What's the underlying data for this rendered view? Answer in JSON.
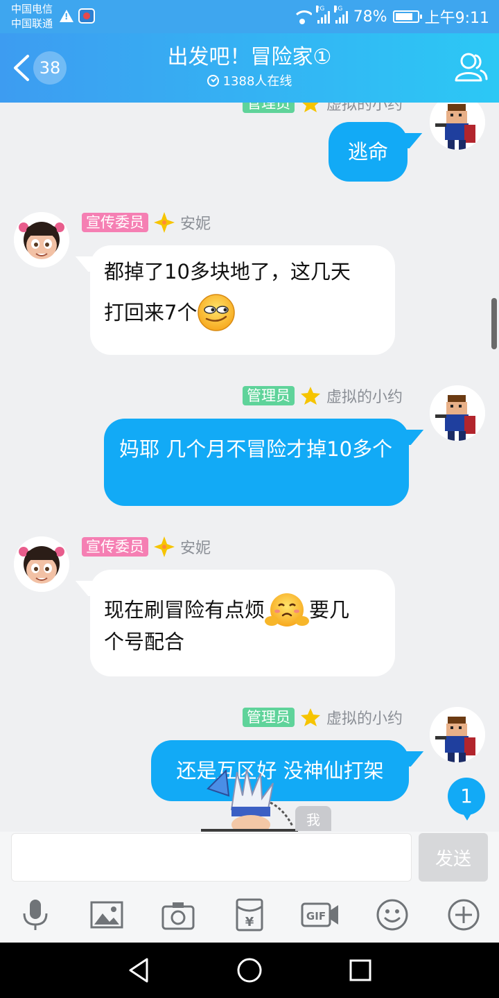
{
  "status_bar": {
    "carrier1": "中国电信",
    "carrier2": "中国联通",
    "signal1_label": "2G",
    "signal2_label": "4G",
    "battery": "78%",
    "time": "上午9:11"
  },
  "header": {
    "back_count": "38",
    "title": "出发吧！冒险家①",
    "online": "1388人在线",
    "colors": {
      "gradient_start": "#3d9cf1",
      "gradient_end": "#2cc8f5"
    }
  },
  "messages": [
    {
      "side": "right",
      "text": "逃命"
    },
    {
      "side": "left",
      "badge": "宣传委员",
      "name": "安妮",
      "line1": "都掉了10多块地了，这几天",
      "line2": "打回来7个",
      "emoji": "smirk-emoji"
    },
    {
      "side": "right",
      "badge": "管理员",
      "name": "虚拟的小约",
      "text": "妈耶 几个月不冒险才掉10多个"
    },
    {
      "side": "left",
      "badge": "宣传委员",
      "name": "安妮",
      "line1a": "现在刷冒险有点烦",
      "line1b": "要几",
      "line2": "个号配合",
      "emoji": "worried-emoji"
    },
    {
      "side": "right",
      "badge": "管理员",
      "name": "虚拟的小约",
      "text": "还是互区好 没神仙打架"
    }
  ],
  "unread_count": "1",
  "me_tag": "我",
  "composer": {
    "send_label": "发送",
    "input_value": ""
  },
  "toolbar_icons": [
    "microphone-icon",
    "image-icon",
    "camera-icon",
    "red-packet-icon",
    "gif-icon",
    "emoji-icon",
    "plus-icon"
  ],
  "accent_color": "#12aaf6"
}
